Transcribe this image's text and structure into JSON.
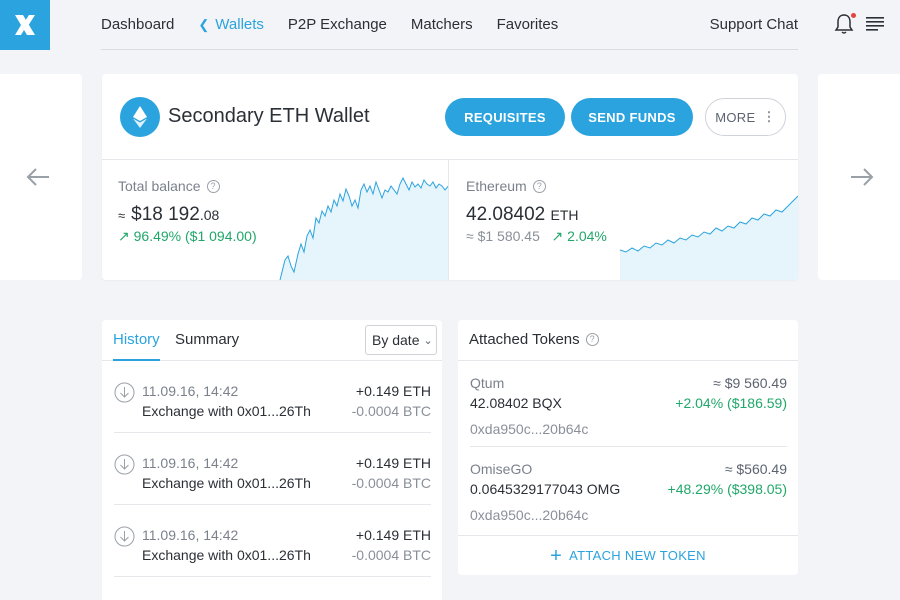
{
  "nav": {
    "items": [
      {
        "label": "Dashboard",
        "active": false
      },
      {
        "label": "Wallets",
        "active": true
      },
      {
        "label": "P2P Exchange",
        "active": false
      },
      {
        "label": "Matchers",
        "active": false
      },
      {
        "label": "Favorites",
        "active": false
      }
    ],
    "support": "Support Chat",
    "icons": {
      "logo": "x-logo-icon",
      "bell": "bell-icon",
      "menu": "menu-icon"
    }
  },
  "colors": {
    "accent": "#2aa3de",
    "positive": "#21a769",
    "notification": "#e4433e"
  },
  "wallet": {
    "title": "Secondary ETH Wallet",
    "icon": "ethereum-icon",
    "buttons": {
      "requisites": "REQUISITES",
      "send": "SEND FUNDS",
      "more": "MORE"
    },
    "total": {
      "label": "Total balance",
      "approx": "≈",
      "value_main": "$18 192",
      "value_cents": ".08",
      "change": "96.49% ($1 094.00)"
    },
    "eth": {
      "label": "Ethereum",
      "value": "42.08402",
      "unit": "ETH",
      "usd": "≈ $1 580.45",
      "change": "2.04%"
    }
  },
  "history": {
    "tabs": {
      "history": "History",
      "summary": "Summary"
    },
    "sort": "By date",
    "rows": [
      {
        "date": "11.09.16, 14:42",
        "desc": "Exchange with 0x01...26Th",
        "amount": "+0.149 ETH",
        "fee": "-0.0004 BTC"
      },
      {
        "date": "11.09.16, 14:42",
        "desc": "Exchange with 0x01...26Th",
        "amount": "+0.149 ETH",
        "fee": "-0.0004 BTC"
      },
      {
        "date": "11.09.16, 14:42",
        "desc": "Exchange with 0x01...26Th",
        "amount": "+0.149 ETH",
        "fee": "-0.0004 BTC"
      }
    ]
  },
  "tokens": {
    "title": "Attached Tokens",
    "items": [
      {
        "name": "Qtum",
        "amount": "42.08402 BQX",
        "address": "0xda950c...20b64c",
        "usd": "≈ $9 560.49",
        "change": "+2.04% ($186.59)"
      },
      {
        "name": "OmiseGO",
        "amount": "0.0645329177043 OMG",
        "address": "0xda950c...20b64c",
        "usd": "≈ $560.49",
        "change": "+48.29% ($398.05)"
      }
    ],
    "attach_label": "ATTACH NEW TOKEN"
  }
}
